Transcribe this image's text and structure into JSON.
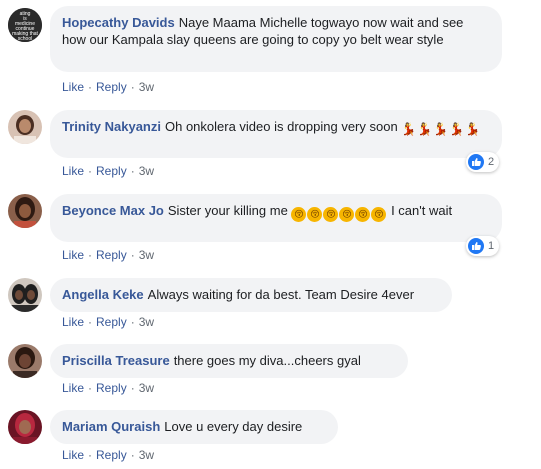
{
  "actions": {
    "like": "Like",
    "reply": "Reply",
    "separator": "·"
  },
  "comments": [
    {
      "author": "Hopecathy Davids",
      "text": "Naye Maama Michelle togwayo now wait and see how our Kampala slay queens are going to copy yo belt wear style",
      "time": "3w",
      "avatar_text": [
        "ating",
        "is",
        "medicine",
        "continue",
        "making that",
        "school"
      ],
      "avatar_color": "#2a2a2a"
    },
    {
      "author": "Trinity Nakyanzi",
      "text": "Oh onkolera video is dropping very soon",
      "emojis": [
        "dancer-emoji",
        "dancer-emoji",
        "dancer-emoji",
        "dancer-emoji",
        "dancer-emoji"
      ],
      "time": "3w",
      "reaction_count": "2",
      "avatar_color": "#c9a58e"
    },
    {
      "author": "Beyonce Max Jo",
      "text": "Sister your killing me",
      "emojis": [
        "kissing-face-emoji",
        "kissing-face-emoji",
        "kissing-face-emoji",
        "kissing-face-emoji",
        "kissing-face-emoji",
        "kissing-face-emoji"
      ],
      "text_after": "I can't wait",
      "time": "3w",
      "reaction_count": "1",
      "avatar_color": "#7a4b36"
    },
    {
      "author": "Angella Keke",
      "text": "Always waiting for da best. Team Desire 4ever",
      "time": "3w",
      "avatar_color": "#3a3a3a"
    },
    {
      "author": "Priscilla Treasure",
      "text": "there goes my diva...cheers gyal",
      "time": "3w",
      "avatar_color": "#6b4637"
    },
    {
      "author": "Mariam Quraish",
      "text": "Love u every day desire",
      "time": "3w",
      "avatar_color": "#b0203a"
    }
  ],
  "colors": {
    "link": "#385898",
    "bubble": "#f2f3f5",
    "like_blue": "#2078f4"
  }
}
